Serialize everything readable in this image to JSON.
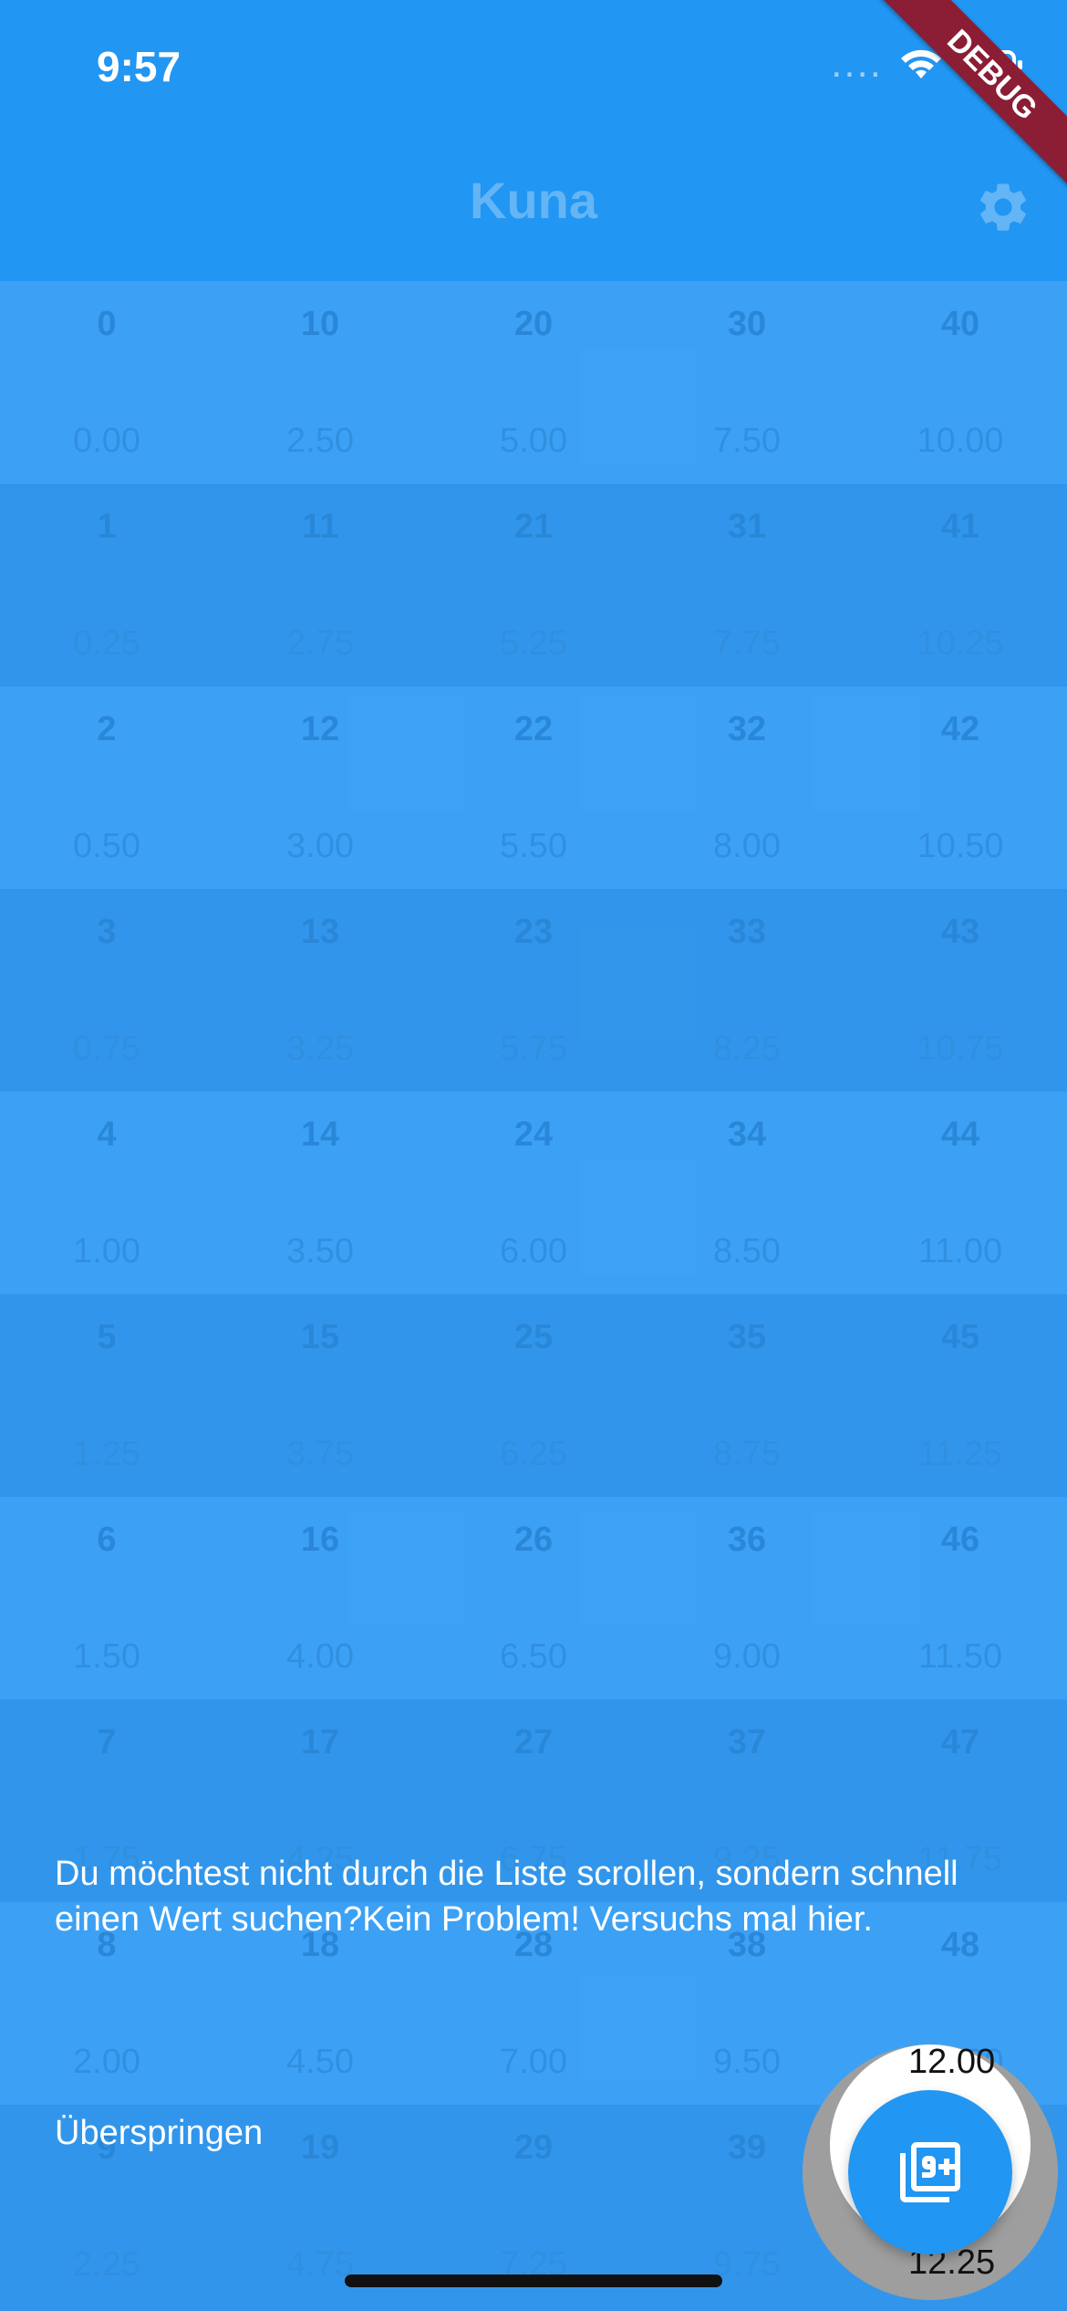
{
  "status_bar": {
    "time": "9:57",
    "signal": "....",
    "icons": [
      "wifi-icon",
      "battery-icon"
    ]
  },
  "debug_banner": "DEBUG",
  "app_bar": {
    "title": "Kuna",
    "settings_icon": "gear-icon"
  },
  "grid": [
    [
      {
        "n": "0",
        "v": "0.00"
      },
      {
        "n": "10",
        "v": "2.50"
      },
      {
        "n": "20",
        "v": "5.00"
      },
      {
        "n": "30",
        "v": "7.50"
      },
      {
        "n": "40",
        "v": "10.00"
      }
    ],
    [
      {
        "n": "1",
        "v": "0.25"
      },
      {
        "n": "11",
        "v": "2.75"
      },
      {
        "n": "21",
        "v": "5.25"
      },
      {
        "n": "31",
        "v": "7.75"
      },
      {
        "n": "41",
        "v": "10.25"
      }
    ],
    [
      {
        "n": "2",
        "v": "0.50"
      },
      {
        "n": "12",
        "v": "3.00"
      },
      {
        "n": "22",
        "v": "5.50"
      },
      {
        "n": "32",
        "v": "8.00"
      },
      {
        "n": "42",
        "v": "10.50"
      }
    ],
    [
      {
        "n": "3",
        "v": "0.75"
      },
      {
        "n": "13",
        "v": "3.25"
      },
      {
        "n": "23",
        "v": "5.75"
      },
      {
        "n": "33",
        "v": "8.25"
      },
      {
        "n": "43",
        "v": "10.75"
      }
    ],
    [
      {
        "n": "4",
        "v": "1.00"
      },
      {
        "n": "14",
        "v": "3.50"
      },
      {
        "n": "24",
        "v": "6.00"
      },
      {
        "n": "34",
        "v": "8.50"
      },
      {
        "n": "44",
        "v": "11.00"
      }
    ],
    [
      {
        "n": "5",
        "v": "1.25"
      },
      {
        "n": "15",
        "v": "3.75"
      },
      {
        "n": "25",
        "v": "6.25"
      },
      {
        "n": "35",
        "v": "8.75"
      },
      {
        "n": "45",
        "v": "11.25"
      }
    ],
    [
      {
        "n": "6",
        "v": "1.50"
      },
      {
        "n": "16",
        "v": "4.00"
      },
      {
        "n": "26",
        "v": "6.50"
      },
      {
        "n": "36",
        "v": "9.00"
      },
      {
        "n": "46",
        "v": "11.50"
      }
    ],
    [
      {
        "n": "7",
        "v": "1.75"
      },
      {
        "n": "17",
        "v": "4.25"
      },
      {
        "n": "27",
        "v": "6.75"
      },
      {
        "n": "37",
        "v": "9.25"
      },
      {
        "n": "47",
        "v": "11.75"
      }
    ],
    [
      {
        "n": "8",
        "v": "2.00"
      },
      {
        "n": "18",
        "v": "4.50"
      },
      {
        "n": "28",
        "v": "7.00"
      },
      {
        "n": "38",
        "v": "9.50"
      },
      {
        "n": "48",
        "v": "12.00"
      }
    ],
    [
      {
        "n": "9",
        "v": "2.25"
      },
      {
        "n": "19",
        "v": "4.75"
      },
      {
        "n": "29",
        "v": "7.25"
      },
      {
        "n": "39",
        "v": "9.75"
      },
      {
        "n": "49",
        "v": "12.25"
      }
    ]
  ],
  "tutorial": {
    "message": "Du möchtest nicht durch die Liste scrollen, sondern schnell einen Wert suchen?Kein Problem! Versuchs mal hier.",
    "skip_label": "Überspringen",
    "spot_value_top": "12.00",
    "spot_value_bottom": "12.25",
    "fab_icon": "filter-9-plus-icon"
  }
}
